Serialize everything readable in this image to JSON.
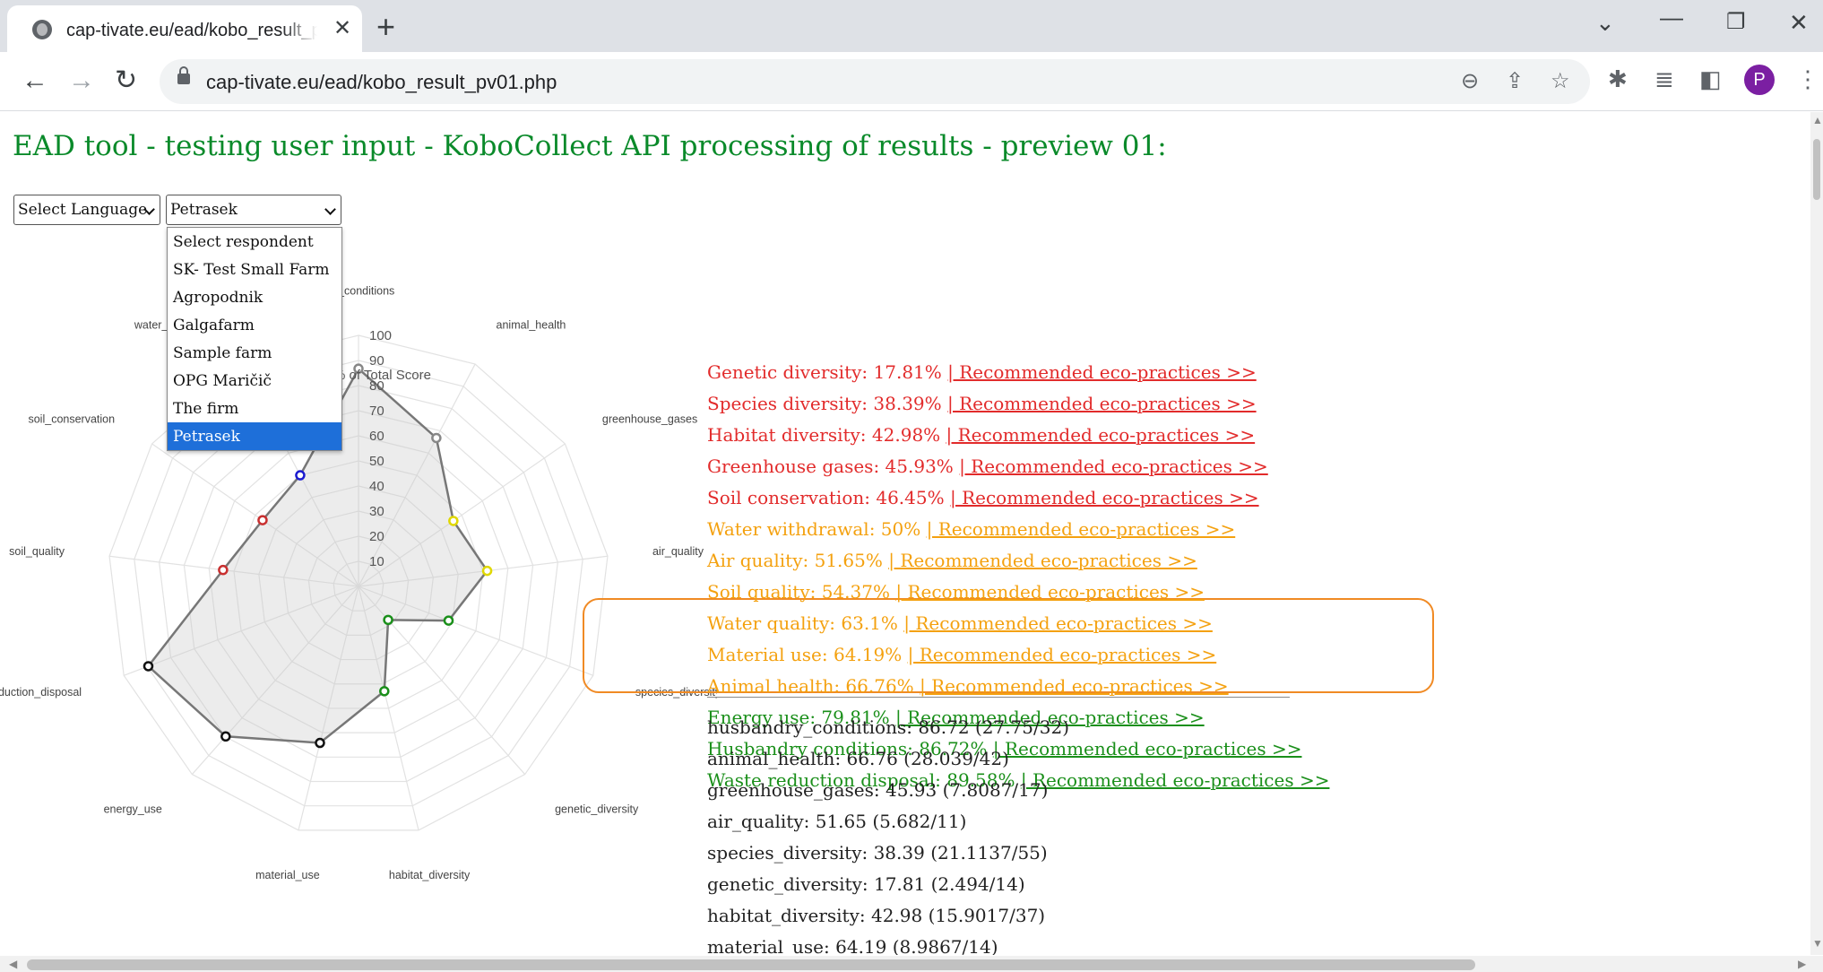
{
  "browser": {
    "tab_title": "cap-tivate.eu/ead/kobo_result_p",
    "url": "cap-tivate.eu/ead/kobo_result_pv01.php",
    "profile_initial": "P"
  },
  "page": {
    "title": "EAD tool - testing user input - KoboCollect API processing of results - preview 01:",
    "language_select": "Select Language",
    "respondent_select": "Petrasek",
    "respondent_options": [
      "Select respondent",
      "SK- Test Small Farm",
      "Agropodnik",
      "Galgafarm",
      "Sample farm",
      "OPG Maričič",
      "The firm",
      "Petrasek"
    ],
    "selected_option_index": 7
  },
  "chart_data": {
    "type": "radar",
    "title_visible_fragment": "% of Total Score",
    "categories": [
      "husbandry_conditions",
      "animal_health",
      "greenhouse_gases",
      "air_quality",
      "species_diversity",
      "genetic_diversity",
      "habitat_diversity",
      "material_use",
      "energy_use",
      "waste_reduction_disposal",
      "soil_quality",
      "soil_conservation",
      "water_withdrawal"
    ],
    "visible_axis_labels": [
      "dry_conditions",
      "animal_health",
      "greenhouse_gases",
      "air_quality",
      "species_diversity",
      "genetic_diversity",
      "habitat_diversity",
      "material_use",
      "energy_use",
      "waste_reduction_disposal",
      "soil_quality",
      "soil_conservation",
      "water_withdrawal"
    ],
    "values": [
      86.72,
      66.76,
      45.93,
      51.65,
      38.39,
      17.81,
      42.98,
      64.19,
      79.81,
      89.58,
      54.37,
      46.45,
      50
    ],
    "point_colors": [
      "#888888",
      "#888888",
      "#e0d800",
      "#e0d800",
      "#1a8f1a",
      "#1a8f1a",
      "#1a8f1a",
      "#111111",
      "#111111",
      "#111111",
      "#c93030",
      "#c93030",
      "#1a1ad0"
    ],
    "r_ticks": [
      10,
      20,
      30,
      40,
      50,
      60,
      70,
      80,
      90,
      100
    ],
    "rlim": [
      0,
      100
    ]
  },
  "results": [
    {
      "label": "Genetic diversity: 17.81%",
      "link": "| Recommended eco-practices >>",
      "color": "red"
    },
    {
      "label": "Species diversity: 38.39%",
      "link": "| Recommended eco-practices >>",
      "color": "red"
    },
    {
      "label": "Habitat diversity: 42.98%",
      "link": "| Recommended eco-practices >>",
      "color": "red"
    },
    {
      "label": "Greenhouse gases: 45.93%",
      "link": "| Recommended eco-practices >>",
      "color": "red"
    },
    {
      "label": "Soil conservation: 46.45%",
      "link": "| Recommended eco-practices >>",
      "color": "red"
    },
    {
      "label": "Water withdrawal: 50%",
      "link": "| Recommended eco-practices >>",
      "color": "orange"
    },
    {
      "label": "Air quality: 51.65%",
      "link": "| Recommended eco-practices >>",
      "color": "orange"
    },
    {
      "label": "Soil quality: 54.37%",
      "link": "| Recommended eco-practices >>",
      "color": "orange"
    },
    {
      "label": "Water quality: 63.1%",
      "link": "| Recommended eco-practices >>",
      "color": "orange"
    },
    {
      "label": "Material use: 64.19%",
      "link": "| Recommended eco-practices >>",
      "color": "orange"
    },
    {
      "label": "Animal health: 66.76%",
      "link": "| Recommended eco-practices >>",
      "color": "orange"
    },
    {
      "label": "Energy use: 79.81%",
      "link": "| Recommended eco-practices >>",
      "color": "green"
    },
    {
      "label": "Husbandry conditions: 86.72%",
      "link": "| Recommended eco-practices >>",
      "color": "green"
    },
    {
      "label": "Waste reduction disposal: 89.58%",
      "link": "| Recommended eco-practices >>",
      "color": "green"
    }
  ],
  "raw_scores": [
    "husbandry_conditions: 86.72 (27.75/32)",
    "animal_health: 66.76 (28.039/42)",
    "greenhouse_gases: 45.93 (7.8087/17)",
    "air_quality: 51.65 (5.682/11)",
    "species_diversity: 38.39 (21.1137/55)",
    "genetic_diversity: 17.81 (2.494/14)",
    "habitat_diversity: 42.98 (15.9017/37)",
    "material_use: 64.19 (8.9867/14)"
  ],
  "colors": {
    "red": "#e22b2b",
    "orange": "#f4a10f",
    "green": "#1a8f1a",
    "title_green": "#0a8a2a",
    "highlight": "#f08a24"
  }
}
